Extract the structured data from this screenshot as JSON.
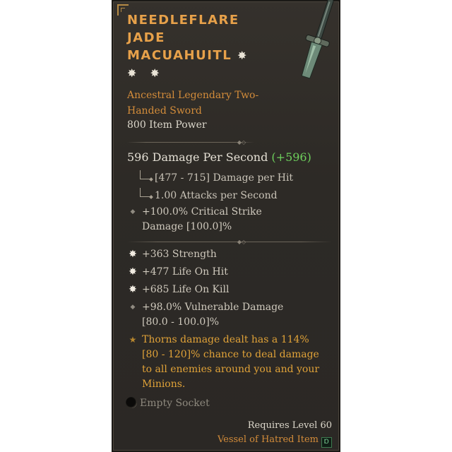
{
  "item": {
    "name_lines": [
      "NEEDLEFLARE",
      "JADE",
      "MACUAHUITL"
    ],
    "type_line": "Ancestral Legendary Two-Handed Sword",
    "item_power": "800 Item Power"
  },
  "weapon": {
    "dps_text": "596 Damage Per Second",
    "dps_gain": "(+596)",
    "damage_per_hit": "[477 - 715] Damage per Hit",
    "attacks_per_second": "1.00 Attacks per Second"
  },
  "implicit": {
    "crit_damage": "+100.0% Critical Strike Damage [100.0]%"
  },
  "affixes": [
    {
      "text": "+363 Strength",
      "bullet": "star"
    },
    {
      "text": "+477 Life On Hit",
      "bullet": "star"
    },
    {
      "text": "+685 Life On Kill",
      "bullet": "star"
    },
    {
      "text": "+98.0% Vulnerable Damage [80.0 - 100.0]%",
      "bullet": "dot"
    }
  ],
  "legendary_aspect": "Thorns damage dealt has a 114% [80 - 120]% chance to deal damage to all enemies around you and your Minions.",
  "socket": "Empty Socket",
  "requirement": "Requires Level 60",
  "expansion": {
    "text": "Vessel of Hatred Item",
    "badge_glyph": "Ɒ"
  },
  "colors": {
    "title": "#e7a14a",
    "legendary_text": "#e0a238",
    "type_line": "#d38c3a",
    "dps_gain": "#6ed05c",
    "background": "#2d2a26"
  },
  "icons": {
    "title_star": "greater-affix-star-icon",
    "socket": "empty-socket-icon",
    "weapon": "macuahuitl-sword-icon"
  }
}
